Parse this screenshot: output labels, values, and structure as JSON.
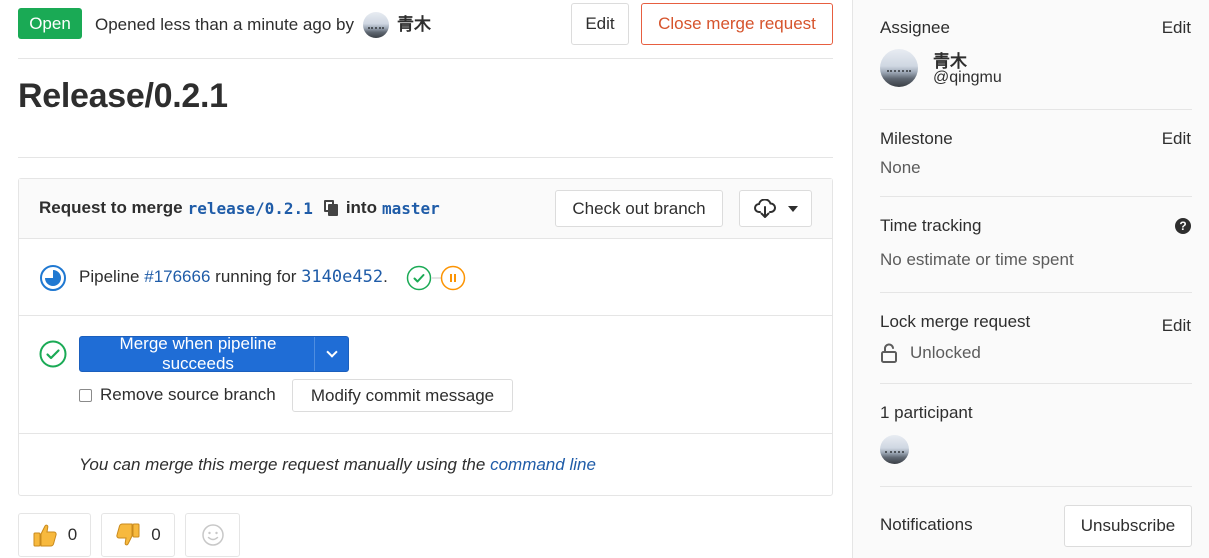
{
  "header": {
    "status": "Open",
    "opened_text": "Opened less than a minute ago by",
    "author": "青木",
    "edit_label": "Edit",
    "close_label": "Close merge request"
  },
  "title": "Release/0.2.1",
  "widget": {
    "request_prefix": "Request to merge",
    "source_branch": "release/0.2.1",
    "into": "into",
    "target_branch": "master",
    "checkout_label": "Check out branch",
    "download_icon": "cloud-download-icon",
    "pipeline": {
      "prefix": "Pipeline",
      "id": "#176666",
      "middle": "running for",
      "commit": "3140e452",
      "suffix": ".",
      "status": "running",
      "stages": [
        {
          "name": "stage-passed",
          "status": "passed"
        },
        {
          "name": "stage-manual",
          "status": "paused"
        }
      ]
    },
    "merge": {
      "button_label": "Merge when pipeline succeeds",
      "remove_source_label": "Remove source branch",
      "remove_source_checked": false,
      "modify_label": "Modify commit message"
    },
    "manual": {
      "text": "You can merge this merge request manually using the",
      "link": "command line"
    }
  },
  "awards": {
    "thumbsup_count": "0",
    "thumbsdown_count": "0"
  },
  "sidebar": {
    "assignee_label": "Assignee",
    "assignee_edit": "Edit",
    "assignee_name": "青木",
    "assignee_username": "@qingmu",
    "milestone_label": "Milestone",
    "milestone_edit": "Edit",
    "milestone_value": "None",
    "time_label": "Time tracking",
    "time_value": "No estimate or time spent",
    "lock_label": "Lock merge request",
    "lock_edit": "Edit",
    "lock_value": "Unlocked",
    "participants_label": "1 participant",
    "notifications_label": "Notifications",
    "unsubscribe_label": "Unsubscribe"
  },
  "colors": {
    "open_green": "#1aaa55",
    "close_orange": "#e75e40",
    "link_blue": "#1f5ca8",
    "merge_blue": "#1f6dd6",
    "success_green": "#1aaa55",
    "manual_orange": "#fc9403"
  }
}
